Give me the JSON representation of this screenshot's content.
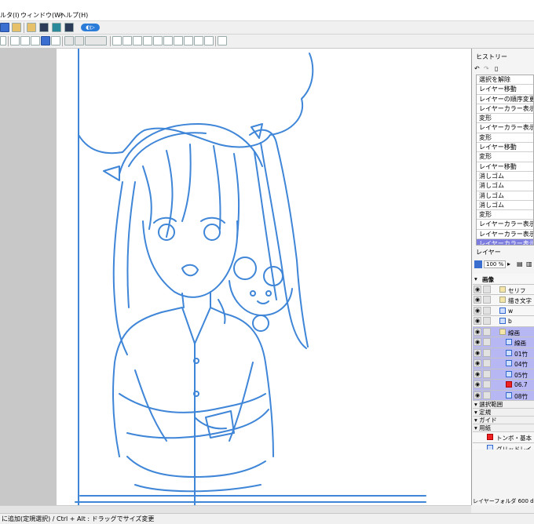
{
  "menu": {
    "items": [
      "ルタ(I)",
      "ウィンドウ(W)",
      "ヘルプ(H)"
    ]
  },
  "history": {
    "title": "ヒストリー",
    "items": [
      "選択を解除",
      "レイヤー移動",
      "レイヤーの順序変更",
      "レイヤーカラー表示の切",
      "変形",
      "レイヤーカラー表示の切",
      "変形",
      "レイヤー移動",
      "変形",
      "レイヤー移動",
      "消しゴム",
      "消しゴム",
      "消しゴム",
      "消しゴム",
      "変形",
      "レイヤーカラー表示の切",
      "レイヤーカラー表示の切",
      "レイヤーカラー表示の"
    ],
    "selected_index": 17
  },
  "layers": {
    "title": "レイヤー",
    "zoom": "100 %",
    "rows": [
      {
        "label": "画像",
        "indent": 0,
        "type": "group"
      },
      {
        "label": "セリフ",
        "indent": 1,
        "type": "folder"
      },
      {
        "label": "描き文字",
        "indent": 1,
        "type": "folder"
      },
      {
        "label": "w",
        "indent": 1,
        "type": "layer"
      },
      {
        "label": "b",
        "indent": 1,
        "type": "layer"
      },
      {
        "label": "線画",
        "indent": 1,
        "type": "folder",
        "highlight": true
      },
      {
        "label": "線画",
        "indent": 2,
        "type": "layer",
        "highlight": true
      },
      {
        "label": "01竹",
        "indent": 2,
        "type": "layer",
        "highlight": true
      },
      {
        "label": "04竹",
        "indent": 2,
        "type": "layer",
        "highlight": true
      },
      {
        "label": "05竹",
        "indent": 2,
        "type": "layer",
        "highlight": true
      },
      {
        "label": "06.7",
        "indent": 2,
        "type": "layer-red",
        "highlight": true
      },
      {
        "label": "08竹",
        "indent": 2,
        "type": "layer",
        "highlight": true
      }
    ],
    "groups": [
      "選択範囲",
      "定規",
      "ガイド",
      "用紙"
    ],
    "paper_rows": [
      "トンボ・基本",
      "グリッドレイ"
    ],
    "footer": "レイヤーフォルダ 600 dpi,ル"
  },
  "status": {
    "text": "に追加(定規選択) / Ctrl + Alt : ドラッグでサイズ変更"
  },
  "colors": {
    "line_art": "#3f86d8",
    "selected_row": "#7d7de0",
    "highlight_row": "#b7b7f4"
  },
  "toolbar": {
    "pill_icon": "cleanup-tool-icon"
  }
}
